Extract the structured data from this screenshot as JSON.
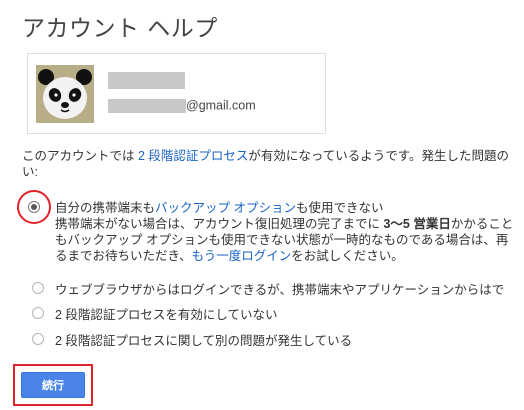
{
  "page": {
    "title": "アカウント ヘルプ"
  },
  "account": {
    "email_suffix": "@gmail.com"
  },
  "intro": {
    "pre": "このアカウントでは ",
    "link": "2 段階認証プロセス",
    "post": "が有効になっているようです。発生した問題の",
    "line2": "い:"
  },
  "options": [
    {
      "pre": "自分の携帯端末も",
      "link": "バックアップ オプション",
      "post": "も使用できない",
      "checked": true,
      "detail": {
        "l1_pre": "携帯端末がない場合は、アカウント復旧処理の完了までに ",
        "l1_bold": "3〜5 営業日",
        "l1_post": "かかること",
        "l2": "もバックアップ オプションも使用できない状態が一時的なものである場合は、再",
        "l3_pre": "るまでお待ちいただき、",
        "l3_link": "もう一度ログイン",
        "l3_post": "をお試しください。"
      }
    },
    {
      "label": "ウェブブラウザからはログインできるが、携帯端末やアプリケーションからはで",
      "checked": false
    },
    {
      "label": "2 段階認証プロセスを有効にしていない",
      "checked": false
    },
    {
      "label": "2 段階認証プロセスに関して別の問題が発生している",
      "checked": false
    }
  ],
  "continue_label": "続行",
  "colors": {
    "link": "#1a63c7",
    "button": "#4a84e8",
    "highlight": "#e0242a"
  }
}
